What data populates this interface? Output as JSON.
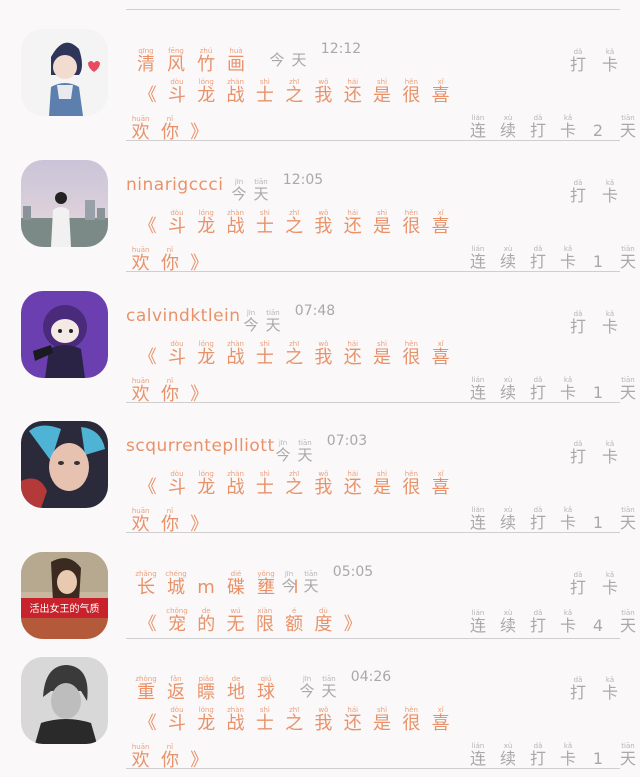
{
  "feed": {
    "punch_label": {
      "chars": [
        [
          "dǎ",
          "打"
        ],
        [
          "kǎ",
          "卡"
        ]
      ]
    },
    "items": [
      {
        "name_chars": [
          [
            "qīng",
            "清"
          ],
          [
            "fēng",
            "风"
          ],
          [
            "zhú",
            "竹"
          ],
          [
            "huà",
            "画"
          ]
        ],
        "name_latin": "",
        "time_chars": [
          [
            "",
            "今"
          ],
          [
            "",
            "天"
          ]
        ],
        "time": "12:12",
        "message_chars": [
          [
            "",
            "《"
          ],
          [
            "dòu",
            "斗"
          ],
          [
            "lóng",
            "龙"
          ],
          [
            "zhàn",
            "战"
          ],
          [
            "shì",
            "士"
          ],
          [
            "zhī",
            "之"
          ],
          [
            "wǒ",
            "我"
          ],
          [
            "hái",
            "还"
          ],
          [
            "shì",
            "是"
          ],
          [
            "hěn",
            "很"
          ],
          [
            "xǐ",
            "喜"
          ]
        ],
        "message_chars2": [
          [
            "huān",
            "欢"
          ],
          [
            "nǐ",
            "你"
          ],
          [
            "",
            "》"
          ]
        ],
        "streak_chars": [
          [
            "lián",
            "连"
          ],
          [
            "xù",
            "续"
          ],
          [
            "dǎ",
            "打"
          ],
          [
            "kǎ",
            "卡"
          ],
          [
            "",
            "2"
          ],
          [
            "tiān",
            "天"
          ]
        ]
      },
      {
        "name_chars": [],
        "name_latin": "ninarigccci",
        "time_chars": [
          [
            "jīn",
            "今"
          ],
          [
            "tiān",
            "天"
          ]
        ],
        "time": "12:05",
        "message_chars": [
          [
            "",
            "《"
          ],
          [
            "dòu",
            "斗"
          ],
          [
            "lóng",
            "龙"
          ],
          [
            "zhàn",
            "战"
          ],
          [
            "shì",
            "士"
          ],
          [
            "zhī",
            "之"
          ],
          [
            "wǒ",
            "我"
          ],
          [
            "hái",
            "还"
          ],
          [
            "shì",
            "是"
          ],
          [
            "hěn",
            "很"
          ],
          [
            "xǐ",
            "喜"
          ]
        ],
        "message_chars2": [
          [
            "huān",
            "欢"
          ],
          [
            "nǐ",
            "你"
          ],
          [
            "",
            "》"
          ]
        ],
        "streak_chars": [
          [
            "lián",
            "连"
          ],
          [
            "xù",
            "续"
          ],
          [
            "dǎ",
            "打"
          ],
          [
            "kǎ",
            "卡"
          ],
          [
            "",
            "1"
          ],
          [
            "tiān",
            "天"
          ]
        ]
      },
      {
        "name_chars": [],
        "name_latin": "calvindktlein",
        "time_chars": [
          [
            "jīn",
            "今"
          ],
          [
            "tiān",
            "天"
          ]
        ],
        "time": "07:48",
        "message_chars": [
          [
            "",
            "《"
          ],
          [
            "dòu",
            "斗"
          ],
          [
            "lóng",
            "龙"
          ],
          [
            "zhàn",
            "战"
          ],
          [
            "shì",
            "士"
          ],
          [
            "zhī",
            "之"
          ],
          [
            "wǒ",
            "我"
          ],
          [
            "hái",
            "还"
          ],
          [
            "shì",
            "是"
          ],
          [
            "hěn",
            "很"
          ],
          [
            "xǐ",
            "喜"
          ]
        ],
        "message_chars2": [
          [
            "huān",
            "欢"
          ],
          [
            "nǐ",
            "你"
          ],
          [
            "",
            "》"
          ]
        ],
        "streak_chars": [
          [
            "lián",
            "连"
          ],
          [
            "xù",
            "续"
          ],
          [
            "dǎ",
            "打"
          ],
          [
            "kǎ",
            "卡"
          ],
          [
            "",
            "1"
          ],
          [
            "tiān",
            "天"
          ]
        ]
      },
      {
        "name_chars": [],
        "name_latin": "scqurrenteplliott",
        "time_chars": [
          [
            "jīn",
            "今"
          ],
          [
            "tiān",
            "天"
          ]
        ],
        "time": "07:03",
        "message_chars": [
          [
            "",
            "《"
          ],
          [
            "dòu",
            "斗"
          ],
          [
            "lóng",
            "龙"
          ],
          [
            "zhàn",
            "战"
          ],
          [
            "shì",
            "士"
          ],
          [
            "zhī",
            "之"
          ],
          [
            "wǒ",
            "我"
          ],
          [
            "hái",
            "还"
          ],
          [
            "shì",
            "是"
          ],
          [
            "hěn",
            "很"
          ],
          [
            "xǐ",
            "喜"
          ]
        ],
        "message_chars2": [
          [
            "huān",
            "欢"
          ],
          [
            "nǐ",
            "你"
          ],
          [
            "",
            "》"
          ]
        ],
        "streak_chars": [
          [
            "lián",
            "连"
          ],
          [
            "xù",
            "续"
          ],
          [
            "dǎ",
            "打"
          ],
          [
            "kǎ",
            "卡"
          ],
          [
            "",
            "1"
          ],
          [
            "tiān",
            "天"
          ]
        ]
      },
      {
        "name_chars": [
          [
            "zhǎng",
            "长"
          ],
          [
            "chéng",
            "城"
          ],
          [
            "",
            "m"
          ],
          [
            "dié",
            "碟"
          ],
          [
            "yǒng",
            "壅"
          ],
          [
            "",
            "l"
          ]
        ],
        "name_latin": "",
        "time_chars": [
          [
            "jīn",
            "今"
          ],
          [
            "tiān",
            "天"
          ]
        ],
        "time": "05:05",
        "message_chars": [
          [
            "",
            "《"
          ],
          [
            "chǒng",
            "宠"
          ],
          [
            "de",
            "的"
          ],
          [
            "wú",
            "无"
          ],
          [
            "xiàn",
            "限"
          ],
          [
            "é",
            "额"
          ],
          [
            "dù",
            "度"
          ],
          [
            "",
            "》"
          ]
        ],
        "message_chars2": [],
        "avatar_caption": "活出女王的气质",
        "streak_chars": [
          [
            "lián",
            "连"
          ],
          [
            "xù",
            "续"
          ],
          [
            "dǎ",
            "打"
          ],
          [
            "kǎ",
            "卡"
          ],
          [
            "",
            "4"
          ],
          [
            "tiān",
            "天"
          ]
        ]
      },
      {
        "name_chars": [
          [
            "zhòng",
            "重"
          ],
          [
            "fǎn",
            "返"
          ],
          [
            "piǎo",
            "瞟"
          ],
          [
            "de",
            "地"
          ],
          [
            "qiú",
            "球"
          ]
        ],
        "name_latin": "",
        "time_chars": [
          [
            "jīn",
            "今"
          ],
          [
            "tiān",
            "天"
          ]
        ],
        "time": "04:26",
        "message_chars": [
          [
            "",
            "《"
          ],
          [
            "dòu",
            "斗"
          ],
          [
            "lóng",
            "龙"
          ],
          [
            "zhàn",
            "战"
          ],
          [
            "shì",
            "士"
          ],
          [
            "zhī",
            "之"
          ],
          [
            "wǒ",
            "我"
          ],
          [
            "hái",
            "还"
          ],
          [
            "shì",
            "是"
          ],
          [
            "hěn",
            "很"
          ],
          [
            "xǐ",
            "喜"
          ]
        ],
        "message_chars2": [
          [
            "huān",
            "欢"
          ],
          [
            "nǐ",
            "你"
          ],
          [
            "",
            "》"
          ]
        ],
        "streak_chars": [
          [
            "lián",
            "连"
          ],
          [
            "xù",
            "续"
          ],
          [
            "dǎ",
            "打"
          ],
          [
            "kǎ",
            "卡"
          ],
          [
            "",
            "1"
          ],
          [
            "tiān",
            "天"
          ]
        ]
      }
    ]
  }
}
